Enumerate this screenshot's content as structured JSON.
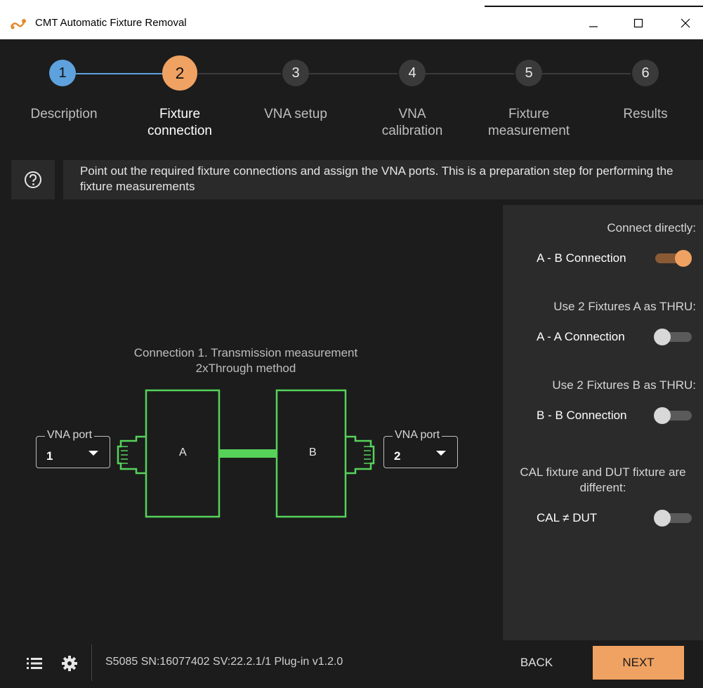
{
  "window": {
    "title": "CMT Automatic Fixture Removal",
    "controls": [
      "minimize",
      "maximize",
      "close"
    ]
  },
  "colors": {
    "accent": "#f0a262",
    "done": "#5ea2dd",
    "fixture_line": "#56d25a",
    "background": "#1c1c1c",
    "panel": "#2b2b2b"
  },
  "stepper": {
    "current_step": 2,
    "steps": [
      {
        "number": "1",
        "label": "Description",
        "state": "done"
      },
      {
        "number": "2",
        "label": "Fixture\nconnection",
        "state": "active"
      },
      {
        "number": "3",
        "label": "VNA setup",
        "state": "pending"
      },
      {
        "number": "4",
        "label": "VNA\ncalibration",
        "state": "pending"
      },
      {
        "number": "5",
        "label": "Fixture\nmeasurement",
        "state": "pending"
      },
      {
        "number": "6",
        "label": "Results",
        "state": "pending"
      }
    ]
  },
  "info": {
    "icon": "question-circle-icon",
    "text": "Point out the required fixture connections and assign the VNA ports. This is a preparation step for performing the fixture measurements"
  },
  "diagram": {
    "title_line1": "Connection 1. Transmission measurement",
    "title_line2": "2xThrough method",
    "fixture_left": "A",
    "fixture_right": "B",
    "port_left": {
      "label": "VNA port",
      "value": "1"
    },
    "port_right": {
      "label": "VNA port",
      "value": "2"
    }
  },
  "options": [
    {
      "caption": "Connect directly:",
      "label": "A - B Connection",
      "on": true
    },
    {
      "caption": "Use 2 Fixtures A as THRU:",
      "label": "A - A Connection",
      "on": false
    },
    {
      "caption": "Use 2 Fixtures B as THRU:",
      "label": "B - B Connection",
      "on": false
    },
    {
      "caption": "CAL fixture and DUT fixture are different:",
      "label": "CAL ≠ DUT",
      "on": false
    }
  ],
  "footer": {
    "status": "S5085 SN:16077402 SV:22.2.1/1 Plug-in v1.2.0",
    "back_label": "BACK",
    "next_label": "NEXT",
    "icons": [
      "list-icon",
      "gear-icon"
    ]
  }
}
